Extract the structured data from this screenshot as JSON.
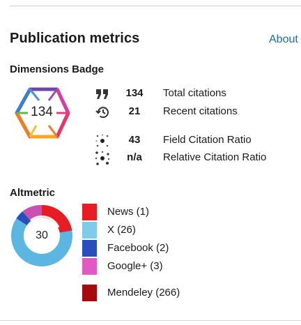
{
  "header": {
    "title": "Publication metrics",
    "about_label": "About"
  },
  "dimensions": {
    "section_label": "Dimensions Badge",
    "badge_value": "134",
    "metrics": [
      {
        "icon": "quote-icon",
        "value": "134",
        "label": "Total citations"
      },
      {
        "icon": "history-icon",
        "value": "21",
        "label": "Recent citations"
      },
      {
        "icon": "field-ratio-icon",
        "value": "43",
        "label": "Field Citation Ratio"
      },
      {
        "icon": "relative-ratio-icon",
        "value": "n/a",
        "label": "Relative Citation Ratio"
      }
    ]
  },
  "altmetric": {
    "section_label": "Altmetric",
    "score": "30",
    "sources": [
      {
        "label": "News (1)",
        "color": "#e81c23"
      },
      {
        "label": "X (26)",
        "color": "#7fcbea"
      },
      {
        "label": "Facebook (2)",
        "color": "#2a4fbd"
      },
      {
        "label": "Google+ (3)",
        "color": "#e159c2"
      },
      {
        "label": "Mendeley (266)",
        "color": "#a8090e"
      }
    ]
  },
  "colors": {
    "link": "#1b6aa8"
  }
}
